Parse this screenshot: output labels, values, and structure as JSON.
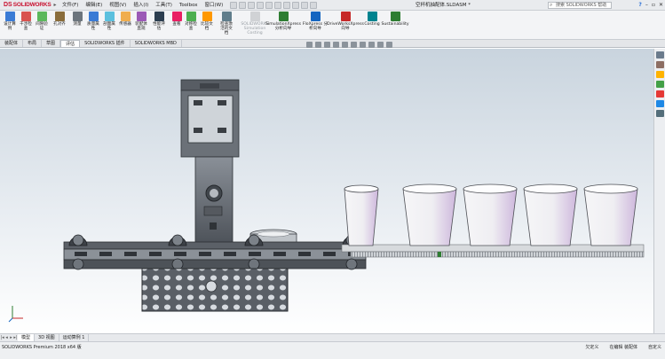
{
  "app": {
    "logo_prefix": "DS",
    "logo_text": "SOLIDWORKS",
    "document_title": "空杯机抽配体.SLDASM *",
    "search_placeholder": "搜索 SOLIDWORKS 帮助"
  },
  "menu": [
    "文件(F)",
    "编辑(E)",
    "视图(V)",
    "插入(I)",
    "工具(T)",
    "Toolbox",
    "窗口(W)"
  ],
  "ribbon": {
    "buttons": [
      {
        "label": "设计算例",
        "color": "#3a7bd5",
        "disabled": false
      },
      {
        "label": "干涉检查",
        "color": "#d9534f",
        "disabled": false
      },
      {
        "label": "间隙验证",
        "color": "#5cb85c",
        "disabled": false
      },
      {
        "label": "孔对齐",
        "color": "#8a6d3b",
        "disabled": false
      },
      {
        "label": "测量",
        "color": "#6c757d",
        "disabled": false
      },
      {
        "label": "质量属性",
        "color": "#3a7bd5",
        "disabled": false
      },
      {
        "label": "剖面属性",
        "color": "#5bc0de",
        "disabled": false
      },
      {
        "label": "传感器",
        "color": "#f0ad4e",
        "disabled": false
      },
      {
        "label": "装配体直观",
        "color": "#9b59b6",
        "disabled": false
      },
      {
        "label": "性能评估",
        "color": "#2c3e50",
        "disabled": false
      },
      {
        "label": "查看",
        "color": "#e91e63",
        "disabled": false
      },
      {
        "label": "对称检查",
        "color": "#4caf50",
        "disabled": false
      },
      {
        "label": "比较文档",
        "color": "#ff9800",
        "disabled": false
      },
      {
        "label": "检查激活的文档",
        "color": "#607d8b",
        "disabled": false
      },
      {
        "label": "SOLIDWORKS Simulation Costing",
        "color": "#9aa0a6",
        "disabled": true
      },
      {
        "label": "SimulationXpress 分析向导",
        "color": "#2e7d32",
        "disabled": false
      },
      {
        "label": "FloXpress 分析向导",
        "color": "#1565c0",
        "disabled": false
      },
      {
        "label": "DriveWorksXpress 向导",
        "color": "#c62828",
        "disabled": false
      },
      {
        "label": "Costing",
        "color": "#00838f",
        "disabled": false
      },
      {
        "label": "Sustainability",
        "color": "#2e7d32",
        "disabled": false
      }
    ]
  },
  "tabs": [
    {
      "label": "装配体",
      "active": false
    },
    {
      "label": "布局",
      "active": false
    },
    {
      "label": "草图",
      "active": false
    },
    {
      "label": "评估",
      "active": true
    },
    {
      "label": "SOLIDWORKS 插件",
      "active": false
    },
    {
      "label": "SOLIDWORKS MBD",
      "active": false
    }
  ],
  "bottom_tabs": [
    {
      "label": "模型",
      "active": true
    },
    {
      "label": "3D 视图",
      "active": false
    },
    {
      "label": "运动算例 1",
      "active": false
    }
  ],
  "status": {
    "left": "SOLIDWORKS Premium 2018 x64 版",
    "right": [
      "欠定义",
      "在编辑 装配体",
      "自定义"
    ]
  },
  "colors": {
    "model_dark": "#4a4f55",
    "model_mid": "#6d737a",
    "model_light": "#a8adb3",
    "cup_white": "#f4f4f6",
    "cup_pink": "#d9c8e3",
    "rack": "#c8ccd0"
  }
}
